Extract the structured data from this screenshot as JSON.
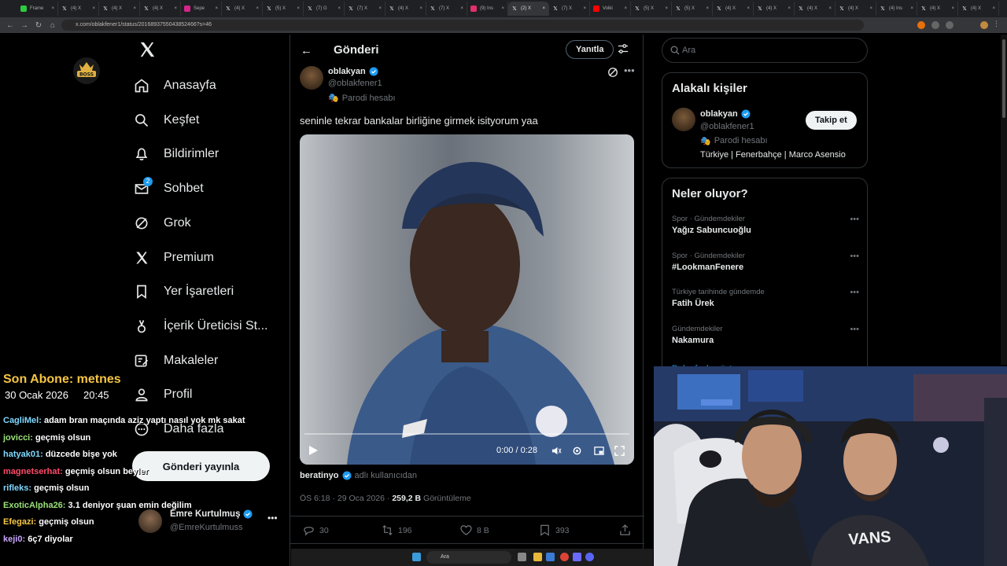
{
  "browser": {
    "tabs": [
      {
        "label": "Frame",
        "icon": "green-favicon",
        "color": "#2ecc40"
      },
      {
        "label": "(4) X",
        "icon": "x-favicon"
      },
      {
        "label": "(4) X",
        "icon": "x-favicon"
      },
      {
        "label": "(4) X",
        "icon": "x-favicon"
      },
      {
        "label": "Sepe",
        "icon": "magenta-favicon",
        "color": "#d6248a"
      },
      {
        "label": "(4) X",
        "icon": "x-favicon"
      },
      {
        "label": "(5) X",
        "icon": "x-favicon"
      },
      {
        "label": "(7) G",
        "icon": "x-favicon"
      },
      {
        "label": "(7) X",
        "icon": "x-favicon"
      },
      {
        "label": "(4) X",
        "icon": "x-favicon"
      },
      {
        "label": "(7) X",
        "icon": "x-favicon"
      },
      {
        "label": "(9) Ins",
        "icon": "instagram-favicon",
        "color": "#e1306c"
      },
      {
        "label": "(2) X",
        "icon": "x-favicon",
        "active": true
      },
      {
        "label": "(7) X",
        "icon": "x-favicon"
      },
      {
        "label": "Volki",
        "icon": "youtube-favicon",
        "color": "#ff0000"
      },
      {
        "label": "(5) X",
        "icon": "x-favicon"
      },
      {
        "label": "(5) X",
        "icon": "x-favicon"
      },
      {
        "label": "(4) X",
        "icon": "x-favicon"
      },
      {
        "label": "(4) X",
        "icon": "x-favicon"
      },
      {
        "label": "(4) X",
        "icon": "x-favicon"
      },
      {
        "label": "(4) X",
        "icon": "x-favicon"
      },
      {
        "label": "(4) Ins",
        "icon": "x-favicon"
      },
      {
        "label": "(4) X",
        "icon": "x-favicon"
      },
      {
        "label": "(4) X",
        "icon": "x-favicon"
      }
    ],
    "url": "x.com/oblakfener1/status/2016893755043852466?s=46"
  },
  "nav": {
    "items": [
      {
        "label": "Anasayfa",
        "icon": "home-icon"
      },
      {
        "label": "Keşfet",
        "icon": "search-icon"
      },
      {
        "label": "Bildirimler",
        "icon": "bell-icon"
      },
      {
        "label": "Sohbet",
        "icon": "mail-icon",
        "badge": "2"
      },
      {
        "label": "Grok",
        "icon": "grok-icon"
      },
      {
        "label": "Premium",
        "icon": "x-premium-icon"
      },
      {
        "label": "Yer İşaretleri",
        "icon": "bookmark-icon"
      },
      {
        "label": "İçerik Üreticisi St...",
        "icon": "creator-studio-icon"
      },
      {
        "label": "Makaleler",
        "icon": "articles-icon"
      },
      {
        "label": "Profil",
        "icon": "person-icon"
      },
      {
        "label": "Daha fazla",
        "icon": "more-circle-icon"
      }
    ],
    "post_button": "Gönderi yayınla",
    "user": {
      "name": "Emre Kurtulmuş",
      "handle": "@EmreKurtulmuss"
    }
  },
  "post": {
    "header_title": "Gönderi",
    "reply_label": "Yanıtla",
    "author_name": "oblakyan",
    "author_handle": "@oblakfener1",
    "parody_label": "Parodi hesabı",
    "text": "seninle tekrar bankalar birliğine girmek isityorum yaa",
    "video_time": "0:00 / 0:28",
    "video_progress": 0,
    "source_user": "beratinyo",
    "source_suffix": "adlı kullanıcıdan",
    "timestamp": "ÖS 6:18 · 29 Oca 2026 · ",
    "views_count": "259,2 B",
    "views_label": " Görüntüleme",
    "replies": "30",
    "reposts": "196",
    "likes": "8 B",
    "bookmarks": "393"
  },
  "right": {
    "search_placeholder": "Ara",
    "related_title": "Alakalı kişiler",
    "related_user": {
      "name": "oblakyan",
      "handle": "@oblakfener1",
      "parody": "Parodi hesabı",
      "bio": "Türkiye | Fenerbahçe | Marco Asensio",
      "follow_label": "Takip et"
    },
    "trends_title": "Neler oluyor?",
    "trends": [
      {
        "category": "Spor · Gündemdekiler",
        "name": "Yağız Sabuncuoğlu"
      },
      {
        "category": "Spor · Gündemdekiler",
        "name": "#LookmanFenere"
      },
      {
        "category": "Türkiye tarihinde gündemde",
        "name": "Fatih Ürek"
      },
      {
        "category": "Gündemdekiler",
        "name": "Nakamura"
      }
    ],
    "show_more": "Daha fazla göster"
  },
  "stream": {
    "sub_title": "Son Abone: metnes",
    "date": "30 Ocak 2026",
    "time": "20:45",
    "chat": [
      {
        "user": "CagliMel:",
        "msg": "adam bran maçında aziz yaptı nasıl yok mk sakat",
        "color": "#7fd8ff"
      },
      {
        "user": "jovicci:",
        "msg": "geçmiş olsun",
        "color": "#9be37a"
      },
      {
        "user": "hatyak01:",
        "msg": "düzcede bişe yok",
        "color": "#7fd8ff"
      },
      {
        "user": "magnetserhat:",
        "msg": "geçmiş olsun beyler",
        "color": "#ff4a6a"
      },
      {
        "user": "rifleks:",
        "msg": "geçmiş olsun",
        "color": "#7fd8ff"
      },
      {
        "user": "ExoticAlpha26:",
        "msg": "3.1 deniyor şuan emin değilim",
        "color": "#9be37a"
      },
      {
        "user": "Efegazi:",
        "msg": "geçmiş olsun",
        "color": "#f5c543"
      },
      {
        "user": "keji0:",
        "msg": "6ç7 diyolar",
        "color": "#c9a6ff"
      }
    ]
  },
  "taskbar": {
    "search_placeholder": "Ara"
  },
  "colors": {
    "verified": "#1d9bf0",
    "accent": "#1d9bf0",
    "background": "#000000",
    "border": "#2f3336"
  }
}
